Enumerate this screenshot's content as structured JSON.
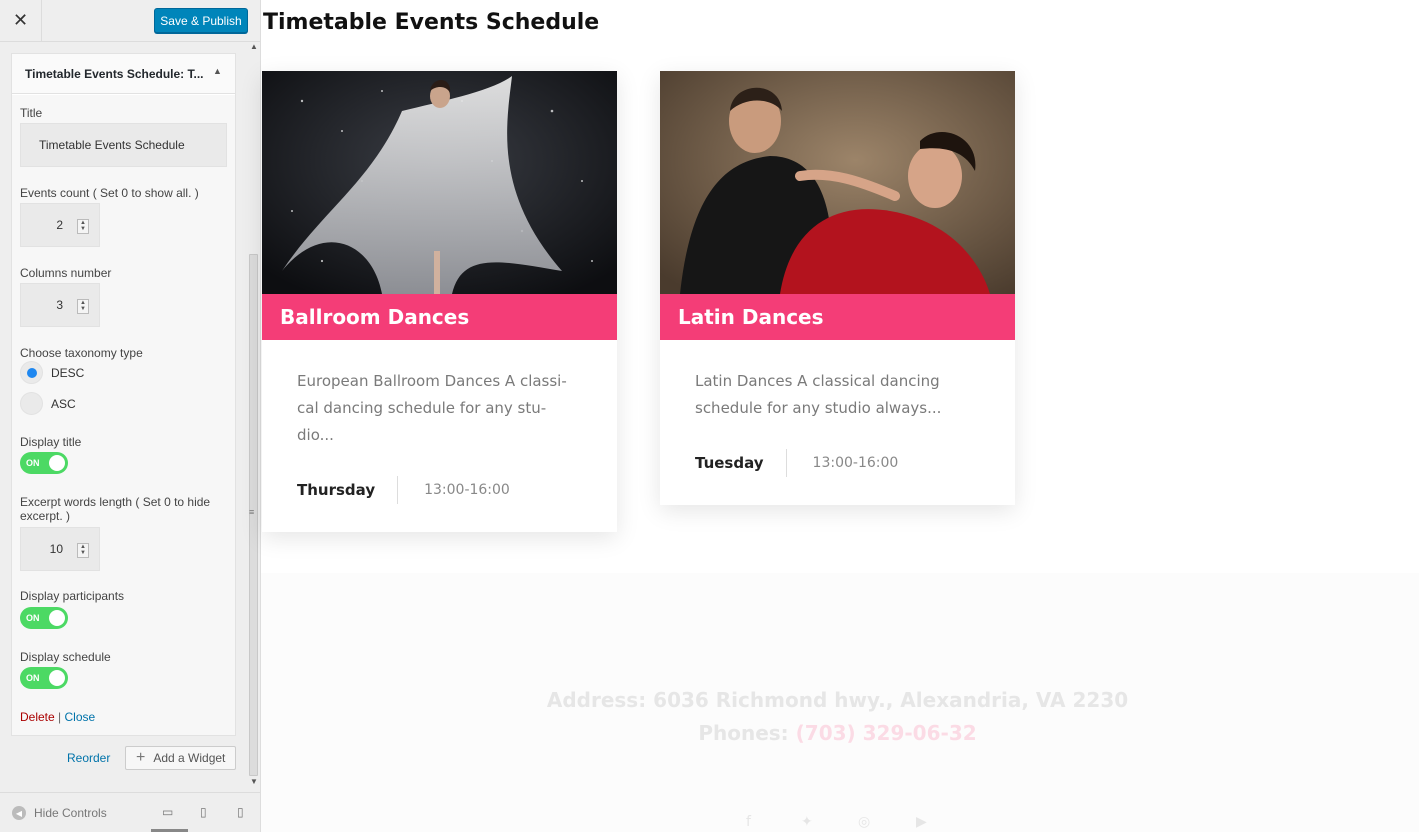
{
  "sidebar": {
    "close_icon": "close-icon",
    "save_label": "Save & Publish",
    "widget_title": "Timetable Events Schedule: T...",
    "fields": {
      "title_label": "Title",
      "title_value": "Timetable Events Schedule",
      "events_count_label": "Events count ( Set 0 to show all. )",
      "events_count_value": "2",
      "columns_label": "Columns number",
      "columns_value": "3",
      "taxonomy_label": "Choose taxonomy type",
      "taxonomy_options": [
        "DESC",
        "ASC"
      ],
      "taxonomy_selected": "DESC",
      "display_title_label": "Display title",
      "excerpt_label": "Excerpt words length ( Set 0 to hide excerpt. )",
      "excerpt_value": "10",
      "display_participants_label": "Display participants",
      "display_schedule_label": "Display schedule",
      "toggle_on_text": "ON"
    },
    "delete_label": "Delete",
    "separator": "|",
    "close_label": "Close",
    "reorder_label": "Reorder",
    "add_widget_label": "Add a Widget",
    "hide_controls_label": "Hide Controls",
    "devices": [
      "desktop-icon",
      "tablet-icon",
      "mobile-icon"
    ]
  },
  "preview": {
    "title": "Timetable Events Schedule",
    "cards": [
      {
        "name": "Ballroom Dances",
        "description": "European Ballroom Dances A classi-cal dancing schedule for any stu-dio...",
        "day": "Thursday",
        "time": "13:00-16:00"
      },
      {
        "name": "Latin Dances",
        "description": "Latin Dances A classical dancing schedule for any studio always...",
        "day": "Tuesday",
        "time": "13:00-16:00"
      }
    ],
    "footer": {
      "address": "Address: 6036 Richmond hwy., Alexandria, VA 2230",
      "phones_label": "Phones: ",
      "phone": "(703) 329-06-32",
      "social": [
        "facebook-icon",
        "twitter-icon",
        "instagram-icon",
        "youtube-icon"
      ]
    }
  },
  "colors": {
    "accent": "#f43d77",
    "publish": "#0085ba",
    "toggle_on": "#4cd964",
    "radio_selected": "#1e87f0"
  }
}
